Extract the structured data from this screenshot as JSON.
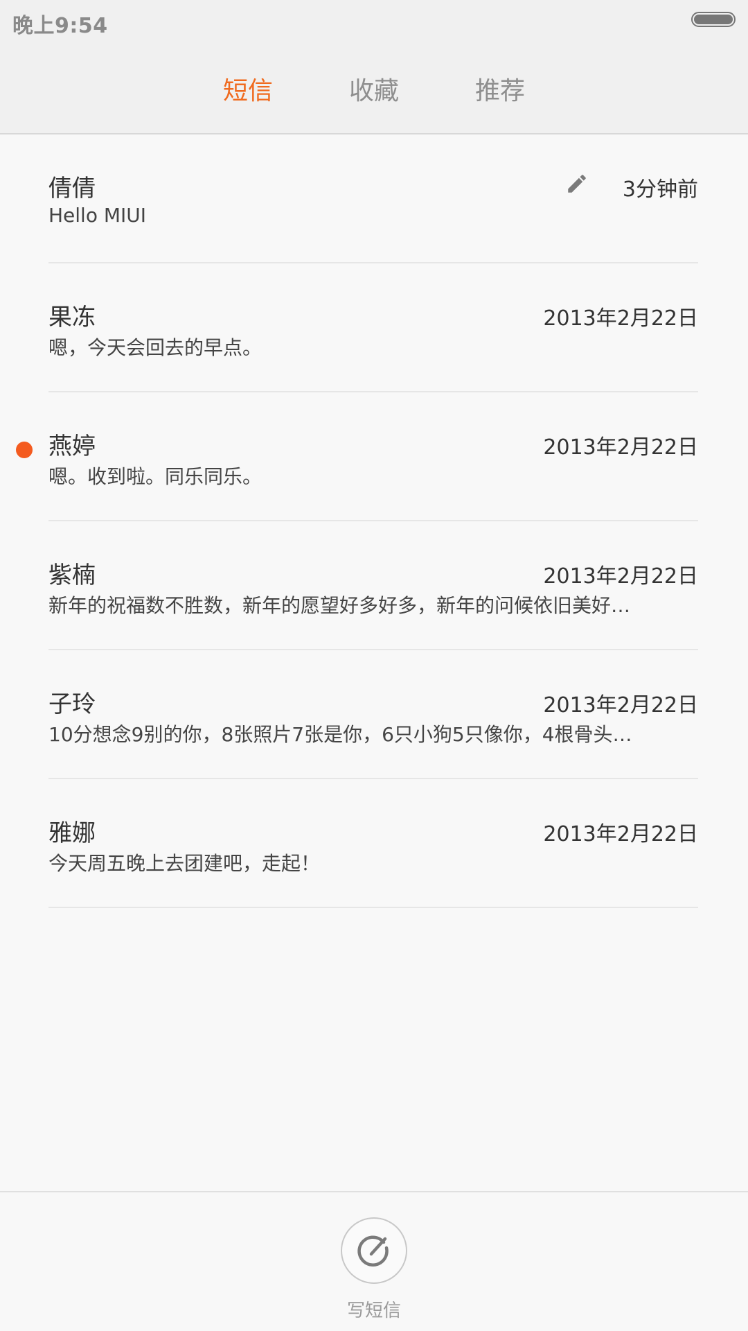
{
  "status_bar": {
    "time": "晚上9:54",
    "battery_icon": "battery-icon"
  },
  "tabs": [
    {
      "label": "短信",
      "active": true
    },
    {
      "label": "收藏",
      "active": false
    },
    {
      "label": "推荐",
      "active": false
    }
  ],
  "colors": {
    "accent": "#f06b1f",
    "unread": "#f45b1f"
  },
  "conversations": [
    {
      "name": "倩倩",
      "time": "3分钟前",
      "snippet": "Hello MIUI",
      "draft": true,
      "unread": false
    },
    {
      "name": "果冻",
      "time": "2013年2月22日",
      "snippet": "嗯，今天会回去的早点。",
      "draft": false,
      "unread": false
    },
    {
      "name": "燕婷",
      "time": "2013年2月22日",
      "snippet": "嗯。收到啦。同乐同乐。",
      "draft": false,
      "unread": true
    },
    {
      "name": "紫楠",
      "time": "2013年2月22日",
      "snippet": "新年的祝福数不胜数，新年的愿望好多好多，新年的问候依旧美好…",
      "draft": false,
      "unread": false
    },
    {
      "name": "子玲",
      "time": "2013年2月22日",
      "snippet": "10分想念9别的你，8张照片7张是你，6只小狗5只像你，4根骨头…",
      "draft": false,
      "unread": false
    },
    {
      "name": "雅娜",
      "time": "2013年2月22日",
      "snippet": "今天周五晚上去团建吧，走起！",
      "draft": false,
      "unread": false
    }
  ],
  "compose": {
    "label": "写短信",
    "icon": "compose-icon"
  }
}
